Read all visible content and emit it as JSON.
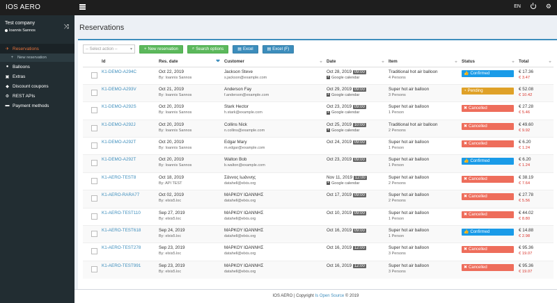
{
  "app": {
    "brand": "IOS AERO",
    "language": "EN"
  },
  "sidebar": {
    "company": "Test company",
    "user": "Ioannis Sannos",
    "items": [
      {
        "label": "Reservations",
        "icon": "plane-icon",
        "active": true
      },
      {
        "label": "New reservation",
        "icon": "plus-icon",
        "sub": true
      },
      {
        "label": "Balloons",
        "icon": "balloon-icon"
      },
      {
        "label": "Extras",
        "icon": "cart-icon"
      },
      {
        "label": "Discount coupons",
        "icon": "ticket-icon"
      },
      {
        "label": "REST APIs",
        "icon": "cog-icon"
      },
      {
        "label": "Payment methods",
        "icon": "card-icon"
      }
    ]
  },
  "page": {
    "title": "Reservations"
  },
  "toolbar": {
    "select_placeholder": "-- Select action --",
    "new_reservation": "New reservation",
    "search_options": "Search options",
    "excel": "Excel",
    "excel_f": "Excel (F)"
  },
  "table": {
    "headers": {
      "id": "Id",
      "res_date": "Res. date",
      "customer": "Customer",
      "date": "Date",
      "item": "Item",
      "status": "Status",
      "total": "Total"
    },
    "rows": [
      {
        "id": "K1-DEMO-A294C",
        "res_date": "Oct 22, 2019",
        "by": "By: Ioannis Sannos",
        "customer": "Jackson Steve",
        "email": "s.jackson@example.com",
        "date": "Oct 28, 2019",
        "time": "09:00",
        "gcal": "Google calendar",
        "item": "Traditional hot air balloon",
        "persons": "4 Persons",
        "status": "Confirmed",
        "status_type": "confirmed",
        "total": "€ 17.36",
        "due": "€ 3.47"
      },
      {
        "id": "K1-DEMO-A293V",
        "res_date": "Oct 21, 2019",
        "by": "By: Ioannis Sannos",
        "customer": "Anderson Fay",
        "email": "f.anderson@example.com",
        "date": "Oct 29, 2019",
        "time": "09:00",
        "gcal": "Google calendar",
        "item": "Super hot air balloon",
        "persons": "3 Persons",
        "status": "Pending",
        "status_type": "pending",
        "total": "€ 52.08",
        "due": "€ 10.42"
      },
      {
        "id": "K1-DEMO-A292S",
        "res_date": "Oct 20, 2019",
        "by": "By: Ioannis Sannos",
        "customer": "Stark Hector",
        "email": "h.stark@example.com",
        "date": "Oct 23, 2019",
        "time": "09:00",
        "gcal": "Google calendar",
        "item": "Super hot air balloon",
        "persons": "1 Person",
        "status": "Cancelled",
        "status_type": "cancelled",
        "total": "€ 27.28",
        "due": "€ 5.46"
      },
      {
        "id": "K1-DEMO-A292J",
        "res_date": "Oct 20, 2019",
        "by": "By: Ioannis Sannos",
        "customer": "Collins Nick",
        "email": "n.collins@example.com",
        "date": "Oct 25, 2019",
        "time": "10:00",
        "gcal": "Google calendar",
        "item": "Traditional hot air balloon",
        "persons": "2 Persons",
        "status": "Cancelled",
        "status_type": "cancelled",
        "total": "€ 49.60",
        "due": "€ 9.92"
      },
      {
        "id": "K1-DEMO-A292T",
        "res_date": "Oct 20, 2019",
        "by": "By: Ioannis Sannos",
        "customer": "Edgar Mary",
        "email": "m.edgar@example.com",
        "date": "Oct 24, 2019",
        "time": "09:00",
        "gcal": "",
        "item": "Super hot air balloon",
        "persons": "1 Person",
        "status": "Cancelled",
        "status_type": "cancelled",
        "total": "€ 6.20",
        "due": "€ 1.24"
      },
      {
        "id": "K1-DEMO-A292T",
        "res_date": "Oct 20, 2019",
        "by": "By: Ioannis Sannos",
        "customer": "Walton Bob",
        "email": "b.walton@example.com",
        "date": "Oct 23, 2019",
        "time": "09:00",
        "gcal": "",
        "item": "Super hot air balloon",
        "persons": "1 Person",
        "status": "Confirmed",
        "status_type": "confirmed",
        "total": "€ 6.20",
        "due": "€ 1.24"
      },
      {
        "id": "K1-AERO-TEST8",
        "res_date": "Oct 18, 2019",
        "by": "By: API TEST",
        "customer": "Σάννος Ιωάννης",
        "email": "datahell@elxis.org",
        "date": "Nov 11, 2019",
        "time": "12:00",
        "gcal": "Google calendar",
        "item": "Super hot air balloon",
        "persons": "2 Persons",
        "status": "Cancelled",
        "status_type": "cancelled",
        "total": "€ 38.19",
        "due": "€ 7.64"
      },
      {
        "id": "K1-AERO-RARA77",
        "res_date": "Oct 02, 2019",
        "by": "By: elxis5.loc",
        "customer": "ΜΑΡΚΟΥ ΙΩΑΝΝΗΣ",
        "email": "datahell@elxis.org",
        "date": "Oct 17, 2019",
        "time": "09:00",
        "gcal": "",
        "item": "Super hot air balloon",
        "persons": "2 Persons",
        "status": "Cancelled",
        "status_type": "cancelled",
        "total": "€ 27.78",
        "due": "€ 5.56"
      },
      {
        "id": "K1-AERO-TEST110",
        "res_date": "Sep 27, 2019",
        "by": "By: elxis5.loc",
        "customer": "ΜΑΡΚΟΥ ΙΩΑΝΝΗΣ",
        "email": "datahell@elxis.org",
        "date": "Oct 10, 2019",
        "time": "09:00",
        "gcal": "",
        "item": "Super hot air balloon",
        "persons": "1 Person",
        "status": "Cancelled",
        "status_type": "cancelled",
        "total": "€ 44.02",
        "due": "€ 8.80"
      },
      {
        "id": "K1-AERO-TEST618",
        "res_date": "Sep 24, 2019",
        "by": "By: elxis5.loc",
        "customer": "ΜΑΡΚΟΥ ΙΩΑΝΝΗΣ",
        "email": "datahell@elxis.org",
        "date": "Oct 16, 2019",
        "time": "09:00",
        "gcal": "",
        "item": "Super hot air balloon",
        "persons": "1 Person",
        "status": "Confirmed",
        "status_type": "confirmed",
        "total": "€ 14.88",
        "due": "€ 2.98"
      },
      {
        "id": "K1-AERO-TEST278",
        "res_date": "Sep 23, 2019",
        "by": "By: elxis5.loc",
        "customer": "ΜΑΡΚΟΥ ΙΩΑΝΝΗΣ",
        "email": "datahell@elxis.org",
        "date": "Oct 16, 2019",
        "time": "12:00",
        "gcal": "",
        "item": "Super hot air balloon",
        "persons": "3 Persons",
        "status": "Cancelled",
        "status_type": "cancelled",
        "total": "€ 95.36",
        "due": "€ 19.07"
      },
      {
        "id": "K1-AERO-TEST991",
        "res_date": "Sep 23, 2019",
        "by": "By: elxis5.loc",
        "customer": "ΜΑΡΚΟΥ ΙΩΑΝΝΗΣ",
        "email": "datahell@elxis.org",
        "date": "Oct 16, 2019",
        "time": "12:00",
        "gcal": "",
        "item": "Super hot air balloon",
        "persons": "3 Persons",
        "status": "Cancelled",
        "status_type": "cancelled",
        "total": "€ 95.36",
        "due": "€ 19.07"
      }
    ]
  },
  "footer": {
    "prefix": "IOS AERO | Copyright",
    "link": "Is Open Source",
    "suffix": "© 2019"
  },
  "colors": {
    "accent": "#3c8dbc",
    "confirmed": "#1a9be8",
    "pending": "#dfa128",
    "cancelled": "#ee6d5b",
    "sidebar": "#222d32",
    "active": "#e8733c"
  }
}
